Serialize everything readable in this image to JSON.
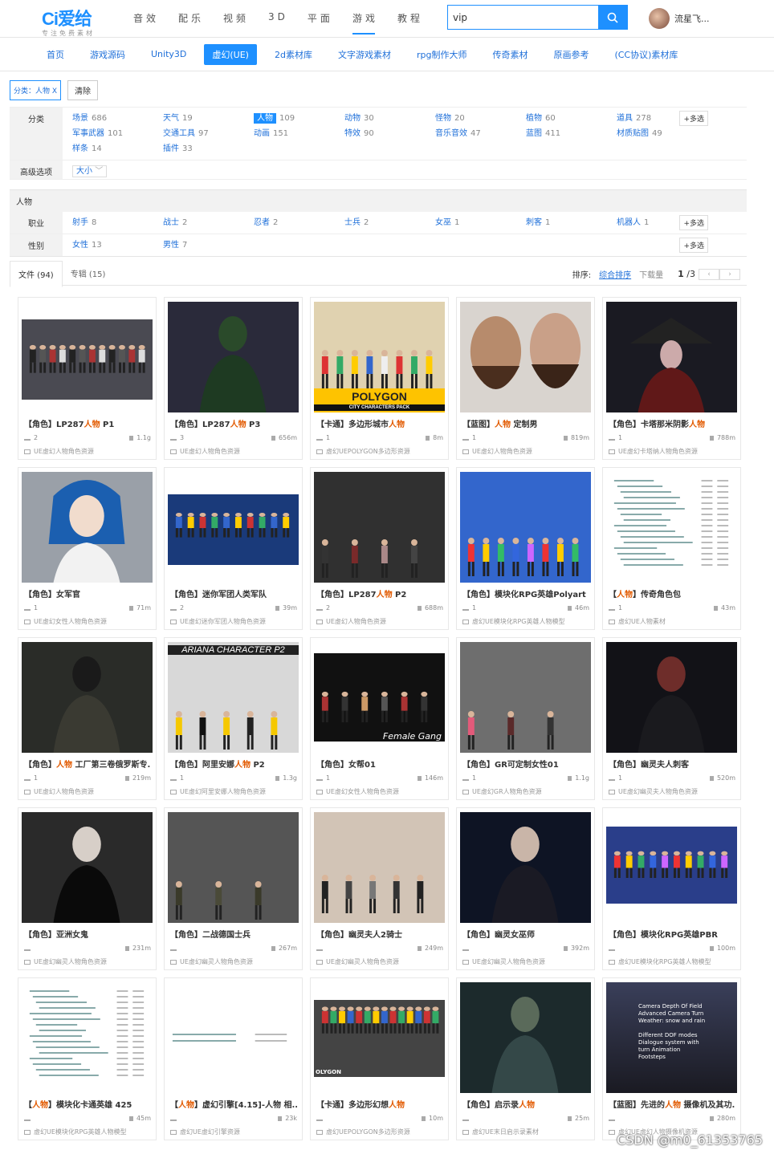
{
  "logo": {
    "mark": "Ci爱给",
    "tagline": "专注免费素材"
  },
  "topnav": [
    {
      "label": "音效"
    },
    {
      "label": "配乐"
    },
    {
      "label": "视频"
    },
    {
      "label": "3D"
    },
    {
      "label": "平面"
    },
    {
      "label": "游戏",
      "active": true
    },
    {
      "label": "教程"
    }
  ],
  "search": {
    "value": "vip"
  },
  "user": {
    "name": "流星飞..."
  },
  "subnav": [
    {
      "label": "首页"
    },
    {
      "label": "游戏源码"
    },
    {
      "label": "Unity3D"
    },
    {
      "label": "虚幻(UE)",
      "active": true
    },
    {
      "label": "2d素材库"
    },
    {
      "label": "文字游戏素材"
    },
    {
      "label": "rpg制作大师"
    },
    {
      "label": "传奇素材"
    },
    {
      "label": "原画参考"
    },
    {
      "label": "(CC协议)素材库"
    }
  ],
  "chips": {
    "selected": "分类：人物 X",
    "clear": "清除"
  },
  "filters": {
    "category_label": "分类",
    "categories": [
      {
        "name": "场景",
        "count": "686"
      },
      {
        "name": "天气",
        "count": "19"
      },
      {
        "name": "人物",
        "count": "109",
        "selected": true
      },
      {
        "name": "动物",
        "count": "30"
      },
      {
        "name": "怪物",
        "count": "20"
      },
      {
        "name": "植物",
        "count": "60"
      },
      {
        "name": "道具",
        "count": "278"
      },
      {
        "name": "军事武器",
        "count": "101"
      },
      {
        "name": "交通工具",
        "count": "97"
      },
      {
        "name": "动画",
        "count": "151"
      },
      {
        "name": "特效",
        "count": "90"
      },
      {
        "name": "音乐音效",
        "count": "47"
      },
      {
        "name": "蓝图",
        "count": "411"
      },
      {
        "name": "材质贴图",
        "count": "49"
      },
      {
        "name": "样条",
        "count": "14"
      },
      {
        "name": "插件",
        "count": "33"
      }
    ],
    "multi": "+多选",
    "advanced_label": "高级选项",
    "size_select": "大小",
    "section": "人物",
    "job_label": "职业",
    "jobs": [
      {
        "name": "射手",
        "count": "8"
      },
      {
        "name": "战士",
        "count": "2"
      },
      {
        "name": "忍者",
        "count": "2"
      },
      {
        "name": "士兵",
        "count": "2"
      },
      {
        "name": "女巫",
        "count": "1"
      },
      {
        "name": "刺客",
        "count": "1"
      },
      {
        "name": "机器人",
        "count": "1"
      }
    ],
    "gender_label": "性别",
    "genders": [
      {
        "name": "女性",
        "count": "13"
      },
      {
        "name": "男性",
        "count": "7"
      }
    ]
  },
  "tabs": [
    {
      "label": "文件 (94)",
      "active": true
    },
    {
      "label": "专辑 (15)"
    }
  ],
  "sort": {
    "label": "排序:",
    "active": "综合排序",
    "other": "下载量",
    "page": "1",
    "total": "/3"
  },
  "cards": [
    {
      "pre": "【角色】LP287",
      "hl": "人物",
      "post": " P1",
      "dl": "2",
      "size": "1.1g",
      "tag": "UE虚幻人物角色资源",
      "img": "a"
    },
    {
      "pre": "【角色】LP287",
      "hl": "人物",
      "post": " P3",
      "dl": "3",
      "size": "656m",
      "tag": "UE虚幻人物角色资源",
      "img": "b"
    },
    {
      "pre": "【卡通】多边形城市",
      "hl": "人物",
      "post": "",
      "dl": "1",
      "size": "8m",
      "tag": "虚幻UEPOLYGON多边形资源",
      "img": "c"
    },
    {
      "pre": "【蓝图】",
      "hl": "人物",
      "post": " 定制男",
      "dl": "1",
      "size": "819m",
      "tag": "UE虚幻人物角色资源",
      "img": "d"
    },
    {
      "pre": "【角色】卡塔那米阴影",
      "hl": "人物",
      "post": "",
      "dl": "1",
      "size": "788m",
      "tag": "UE虚幻卡塔纳人物角色资源",
      "img": "e"
    },
    {
      "pre": "【角色】女军官",
      "hl": "",
      "post": "",
      "dl": "1",
      "size": "71m",
      "tag": "UE虚幻女性人物角色资源",
      "img": "f"
    },
    {
      "pre": "【角色】迷你军团人类军队",
      "hl": "",
      "post": "",
      "dl": "2",
      "size": "39m",
      "tag": "UE虚幻迷你军团人物角色资源",
      "img": "g"
    },
    {
      "pre": "【角色】LP287",
      "hl": "人物",
      "post": " P2",
      "dl": "2",
      "size": "688m",
      "tag": "UE虚幻人物角色资源",
      "img": "h"
    },
    {
      "pre": "【角色】模块化RPG英雄Polyart",
      "hl": "",
      "post": "",
      "dl": "1",
      "size": "46m",
      "tag": "虚幻UE模块化RPG英雄人物模型",
      "img": "i"
    },
    {
      "pre": "【",
      "hl": "人物",
      "post": "】传奇角色包",
      "dl": "1",
      "size": "43m",
      "tag": "虚幻UE人物素材",
      "img": "j"
    },
    {
      "pre": "【角色】",
      "hl": "人物",
      "post": " 工厂第三卷俄罗斯专...",
      "dl": "1",
      "size": "219m",
      "tag": "UE虚幻人物角色资源",
      "img": "k"
    },
    {
      "pre": "【角色】阿里安娜",
      "hl": "人物",
      "post": " P2",
      "dl": "1",
      "size": "1.3g",
      "tag": "UE虚幻阿里安娜人物角色资源",
      "img": "l"
    },
    {
      "pre": "【角色】女帮01",
      "hl": "",
      "post": "",
      "dl": "1",
      "size": "146m",
      "tag": "UE虚幻女性人物角色资源",
      "img": "m"
    },
    {
      "pre": "【角色】GR可定制女性01",
      "hl": "",
      "post": "",
      "dl": "1",
      "size": "1.1g",
      "tag": "UE虚幻GR人物角色资源",
      "img": "n"
    },
    {
      "pre": "【角色】幽灵夫人刺客",
      "hl": "",
      "post": "",
      "dl": "1",
      "size": "520m",
      "tag": "UE虚幻幽灵夫人物角色资源",
      "img": "o"
    },
    {
      "pre": "【角色】亚洲女鬼",
      "hl": "",
      "post": "",
      "dl": "",
      "size": "231m",
      "tag": "UE虚幻幽灵人物角色资源",
      "img": "p"
    },
    {
      "pre": "【角色】二战德国士兵",
      "hl": "",
      "post": "",
      "dl": "",
      "size": "267m",
      "tag": "UE虚幻幽灵人物角色资源",
      "img": "q"
    },
    {
      "pre": "【角色】幽灵夫人2骑士",
      "hl": "",
      "post": "",
      "dl": "",
      "size": "249m",
      "tag": "UE虚幻幽灵人物角色资源",
      "img": "r"
    },
    {
      "pre": "【角色】幽灵女巫师",
      "hl": "",
      "post": "",
      "dl": "",
      "size": "392m",
      "tag": "UE虚幻幽灵人物角色资源",
      "img": "s"
    },
    {
      "pre": "【角色】模块化RPG英雄PBR",
      "hl": "",
      "post": "",
      "dl": "",
      "size": "100m",
      "tag": "虚幻UE模块化RPG英雄人物模型",
      "img": "t"
    },
    {
      "pre": "【",
      "hl": "人物",
      "post": "】模块化卡通英雄 425",
      "dl": "",
      "size": "45m",
      "tag": "虚幻UE模块化RPG英雄人物模型",
      "img": "u"
    },
    {
      "pre": "【",
      "hl": "人物",
      "post": "】虚幻引擎[4.15]-人物 相...",
      "dl": "",
      "size": "23k",
      "tag": "虚幻UE虚幻引擎资源",
      "img": "v"
    },
    {
      "pre": "【卡通】多边形幻想",
      "hl": "人物",
      "post": "",
      "dl": "",
      "size": "10m",
      "tag": "虚幻UEPOLYGON多边形资源",
      "img": "w"
    },
    {
      "pre": "【角色】启示录",
      "hl": "人物",
      "post": "",
      "dl": "",
      "size": "25m",
      "tag": "虚幻UE末日启示录素材",
      "img": "x"
    },
    {
      "pre": "【蓝图】先进的",
      "hl": "人物",
      "post": " 摄像机及其功...",
      "dl": "",
      "size": "280m",
      "tag": "虚幻UE虚幻人物摄像机资源",
      "img": "y"
    }
  ],
  "thumb_text": {
    "polygon": "POLYGON",
    "polygon_sub": "CITY CHARACTERS PACK",
    "ariana": "ARIANA CHARACTER P2",
    "female_gang": "Female Gang",
    "camera": "Camera Depth Of Field\nAdvanced Camera Turn\nWeather: snow and rain\n\nDifferent DOF modes\nDialogue system with\nturn Animation\nFootsteps",
    "polygon_small": "OLYGON"
  },
  "watermark": "CSDN @m0_61353765"
}
